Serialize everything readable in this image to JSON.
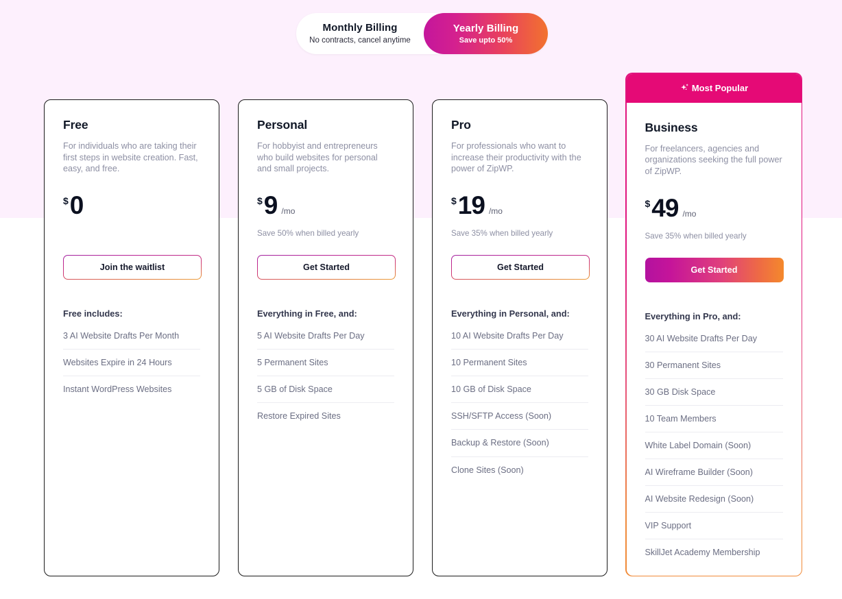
{
  "billing_toggle": {
    "monthly": {
      "title": "Monthly Billing",
      "subtitle": "No contracts, cancel anytime"
    },
    "yearly": {
      "title": "Yearly Billing",
      "subtitle": "Save upto 50%"
    },
    "active": "yearly",
    "active_gradient_from": "#c4169c",
    "active_gradient_to": "#f2722e"
  },
  "badge": {
    "label": "Most Popular",
    "background": "#e50a76",
    "icon": "sparkle-icon"
  },
  "plans": [
    {
      "name": "Free",
      "description": "For individuals who are taking their first steps in website creation. Fast, easy, and free.",
      "currency": "$",
      "amount": "0",
      "period": "",
      "save_note": "",
      "cta": "Join the waitlist",
      "cta_style": "outline",
      "includes_title": "Free includes:",
      "features": [
        "3 AI Website Drafts Per Month",
        "Websites Expire in 24 Hours",
        "Instant WordPress Websites"
      ]
    },
    {
      "name": "Personal",
      "description": "For hobbyist and entrepreneurs who build websites for personal and small projects.",
      "currency": "$",
      "amount": "9",
      "period": "/mo",
      "save_note": "Save 50% when billed yearly",
      "cta": "Get Started",
      "cta_style": "outline",
      "includes_title": "Everything in Free, and:",
      "features": [
        "5 AI Website Drafts Per Day",
        "5 Permanent Sites",
        "5 GB of Disk Space",
        "Restore Expired Sites"
      ]
    },
    {
      "name": "Pro",
      "description": "For professionals who want to increase their productivity with the power of ZipWP.",
      "currency": "$",
      "amount": "19",
      "period": "/mo",
      "save_note": "Save 35% when billed yearly",
      "cta": "Get Started",
      "cta_style": "outline",
      "includes_title": "Everything in Personal, and:",
      "features": [
        "10 AI Website Drafts Per Day",
        "10 Permanent Sites",
        "10 GB of Disk Space",
        "SSH/SFTP Access (Soon)",
        "Backup & Restore (Soon)",
        "Clone Sites (Soon)"
      ]
    },
    {
      "name": "Business",
      "description": "For freelancers, agencies and organizations seeking the full power of ZipWP.",
      "currency": "$",
      "amount": "49",
      "period": "/mo",
      "save_note": "Save 35% when billed yearly",
      "cta": "Get Started",
      "cta_style": "gradient",
      "includes_title": "Everything in Pro, and:",
      "features": [
        "30 AI Website Drafts Per Day",
        "30 Permanent Sites",
        "30 GB Disk Space",
        "10 Team Members",
        "White Label Domain (Soon)",
        "AI Wireframe Builder (Soon)",
        "AI Website Redesign (Soon)",
        "VIP Support",
        "SkillJet Academy Membership"
      ]
    }
  ]
}
